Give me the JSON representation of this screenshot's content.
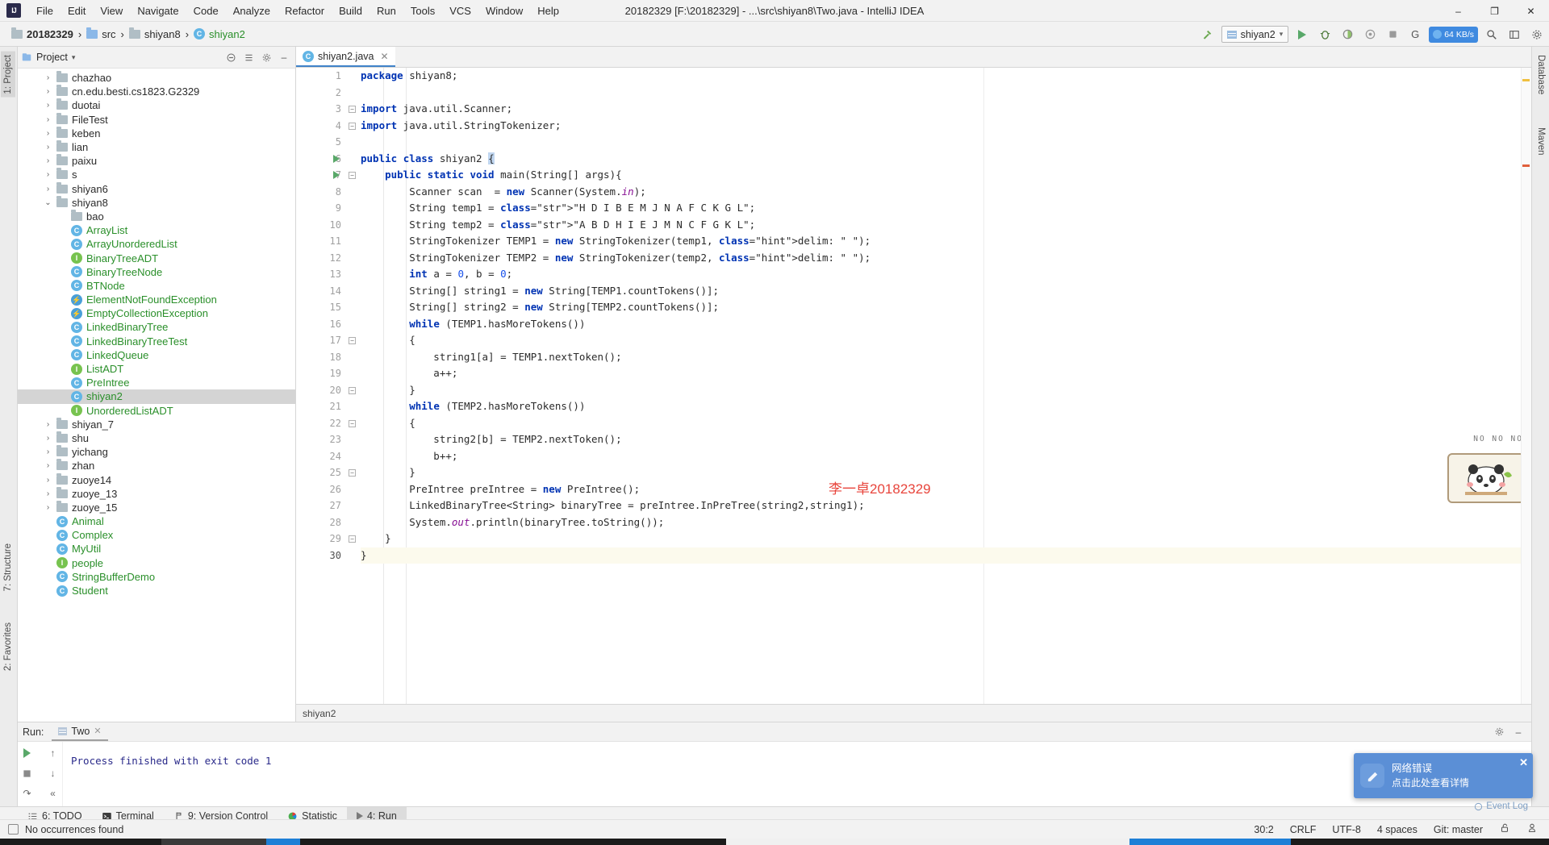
{
  "window": {
    "title": "20182329 [F:\\20182329] - ...\\src\\shiyan8\\Two.java - IntelliJ IDEA",
    "logo": "IJ",
    "minimize": "–",
    "maximize": "❐",
    "close": "✕"
  },
  "menu": [
    "File",
    "Edit",
    "View",
    "Navigate",
    "Code",
    "Analyze",
    "Refactor",
    "Build",
    "Run",
    "Tools",
    "VCS",
    "Window",
    "Help"
  ],
  "breadcrumbs": [
    {
      "label": "20182329",
      "icon": "module-icon",
      "type": "module"
    },
    {
      "label": "src",
      "icon": "source-folder-icon",
      "type": "src"
    },
    {
      "label": "shiyan8",
      "icon": "package-folder-icon",
      "type": "folder"
    },
    {
      "label": "shiyan2",
      "icon": "java-class-icon",
      "type": "class"
    }
  ],
  "toolbar": {
    "build_icon": "hammer-icon",
    "run_config": "shiyan2",
    "run_icon": "run-icon",
    "debug_icon": "debug-icon",
    "coverage_icon": "run-with-coverage-icon",
    "profile_icon": "profiler-icon",
    "stop_icon": "stop-icon",
    "search_icon": "search-icon",
    "layout_icon": "layout-icon",
    "settings_icon": "settings-icon",
    "net_speed": "64 KB/s",
    "git_label": "G"
  },
  "left_tool_tabs": [
    {
      "label": "1: Project",
      "active": true
    },
    {
      "label": "7: Structure",
      "active": false
    },
    {
      "label": "2: Favorites",
      "active": false
    }
  ],
  "right_tool_tabs": [
    {
      "label": "Database",
      "active": false
    },
    {
      "label": "Maven",
      "active": false
    }
  ],
  "project_panel": {
    "title": "Project",
    "chevron": "▾",
    "icons": [
      "collapse-all-icon",
      "expand-all-icon",
      "settings-icon",
      "hide-icon"
    ],
    "tree": [
      {
        "label": "chazhao",
        "depth": 1,
        "type": "folder",
        "arrow": "›",
        "selected": false
      },
      {
        "label": "cn.edu.besti.cs1823.G2329",
        "depth": 1,
        "type": "folder",
        "arrow": "›",
        "selected": false
      },
      {
        "label": "duotai",
        "depth": 1,
        "type": "folder",
        "arrow": "›",
        "selected": false
      },
      {
        "label": "FileTest",
        "depth": 1,
        "type": "folder",
        "arrow": "›",
        "selected": false
      },
      {
        "label": "keben",
        "depth": 1,
        "type": "folder",
        "arrow": "›",
        "selected": false
      },
      {
        "label": "lian",
        "depth": 1,
        "type": "folder",
        "arrow": "›",
        "selected": false
      },
      {
        "label": "paixu",
        "depth": 1,
        "type": "folder",
        "arrow": "›",
        "selected": false
      },
      {
        "label": "s",
        "depth": 1,
        "type": "folder",
        "arrow": "›",
        "selected": false
      },
      {
        "label": "shiyan6",
        "depth": 1,
        "type": "folder",
        "arrow": "›",
        "selected": false
      },
      {
        "label": "shiyan8",
        "depth": 1,
        "type": "folder",
        "arrow": "⌄",
        "selected": false
      },
      {
        "label": "bao",
        "depth": 2,
        "type": "folder",
        "arrow": "",
        "selected": false
      },
      {
        "label": "ArrayList",
        "depth": 2,
        "type": "class",
        "arrow": "",
        "selected": false
      },
      {
        "label": "ArrayUnorderedList",
        "depth": 2,
        "type": "class",
        "arrow": "",
        "selected": false
      },
      {
        "label": "BinaryTreeADT",
        "depth": 2,
        "type": "interface",
        "arrow": "",
        "selected": false
      },
      {
        "label": "BinaryTreeNode",
        "depth": 2,
        "type": "class",
        "arrow": "",
        "selected": false
      },
      {
        "label": "BTNode",
        "depth": 2,
        "type": "class",
        "arrow": "",
        "selected": false
      },
      {
        "label": "ElementNotFoundException",
        "depth": 2,
        "type": "exception",
        "arrow": "",
        "selected": false
      },
      {
        "label": "EmptyCollectionException",
        "depth": 2,
        "type": "exception",
        "arrow": "",
        "selected": false
      },
      {
        "label": "LinkedBinaryTree",
        "depth": 2,
        "type": "class",
        "arrow": "",
        "selected": false
      },
      {
        "label": "LinkedBinaryTreeTest",
        "depth": 2,
        "type": "class-run",
        "arrow": "",
        "selected": false
      },
      {
        "label": "LinkedQueue",
        "depth": 2,
        "type": "class",
        "arrow": "",
        "selected": false
      },
      {
        "label": "ListADT",
        "depth": 2,
        "type": "interface",
        "arrow": "",
        "selected": false
      },
      {
        "label": "PreIntree",
        "depth": 2,
        "type": "class",
        "arrow": "",
        "selected": false
      },
      {
        "label": "shiyan2",
        "depth": 2,
        "type": "class-run",
        "arrow": "",
        "selected": true
      },
      {
        "label": "UnorderedListADT",
        "depth": 2,
        "type": "interface",
        "arrow": "",
        "selected": false
      },
      {
        "label": "shiyan_7",
        "depth": 1,
        "type": "folder",
        "arrow": "›",
        "selected": false
      },
      {
        "label": "shu",
        "depth": 1,
        "type": "folder",
        "arrow": "›",
        "selected": false
      },
      {
        "label": "yichang",
        "depth": 1,
        "type": "folder",
        "arrow": "›",
        "selected": false
      },
      {
        "label": "zhan",
        "depth": 1,
        "type": "folder",
        "arrow": "›",
        "selected": false
      },
      {
        "label": "zuoye14",
        "depth": 1,
        "type": "folder",
        "arrow": "›",
        "selected": false
      },
      {
        "label": "zuoye_13",
        "depth": 1,
        "type": "folder",
        "arrow": "›",
        "selected": false
      },
      {
        "label": "zuoye_15",
        "depth": 1,
        "type": "folder",
        "arrow": "›",
        "selected": false
      },
      {
        "label": "Animal",
        "depth": 1,
        "type": "class-run",
        "arrow": "",
        "selected": false
      },
      {
        "label": "Complex",
        "depth": 1,
        "type": "class",
        "arrow": "",
        "selected": false
      },
      {
        "label": "MyUtil",
        "depth": 1,
        "type": "class",
        "arrow": "",
        "selected": false
      },
      {
        "label": "people",
        "depth": 1,
        "type": "interface",
        "arrow": "",
        "selected": false
      },
      {
        "label": "StringBufferDemo",
        "depth": 1,
        "type": "class-run",
        "arrow": "",
        "selected": false
      },
      {
        "label": "Student",
        "depth": 1,
        "type": "class",
        "arrow": "",
        "selected": false
      }
    ]
  },
  "editor": {
    "tab": {
      "label": "shiyan2.java",
      "icon": "java-class-icon",
      "close": "✕"
    },
    "breadcrumb_bottom": "shiyan2",
    "watermark": "李一卓",
    "watermark_full": "李一卓20182329",
    "lines": [
      {
        "n": 1,
        "text": "package shiyan8;"
      },
      {
        "n": 2,
        "text": ""
      },
      {
        "n": 3,
        "text": "import java.util.Scanner;"
      },
      {
        "n": 4,
        "text": "import java.util.StringTokenizer;"
      },
      {
        "n": 5,
        "text": ""
      },
      {
        "n": 6,
        "text": "public class shiyan2 {"
      },
      {
        "n": 7,
        "text": "    public static void main(String[] args){"
      },
      {
        "n": 8,
        "text": "        Scanner scan  = new Scanner(System.in);"
      },
      {
        "n": 9,
        "text": "        String temp1 = \"H D I B E M J N A F C K G L\";"
      },
      {
        "n": 10,
        "text": "        String temp2 = \"A B D H I E J M N C F G K L\";"
      },
      {
        "n": 11,
        "text": "        StringTokenizer TEMP1 = new StringTokenizer(temp1, delim: \" \");"
      },
      {
        "n": 12,
        "text": "        StringTokenizer TEMP2 = new StringTokenizer(temp2, delim: \" \");"
      },
      {
        "n": 13,
        "text": "        int a = 0, b = 0;"
      },
      {
        "n": 14,
        "text": "        String[] string1 = new String[TEMP1.countTokens()];"
      },
      {
        "n": 15,
        "text": "        String[] string2 = new String[TEMP2.countTokens()];"
      },
      {
        "n": 16,
        "text": "        while (TEMP1.hasMoreTokens())"
      },
      {
        "n": 17,
        "text": "        {"
      },
      {
        "n": 18,
        "text": "            string1[a] = TEMP1.nextToken();"
      },
      {
        "n": 19,
        "text": "            a++;"
      },
      {
        "n": 20,
        "text": "        }"
      },
      {
        "n": 21,
        "text": "        while (TEMP2.hasMoreTokens())"
      },
      {
        "n": 22,
        "text": "        {"
      },
      {
        "n": 23,
        "text": "            string2[b] = TEMP2.nextToken();"
      },
      {
        "n": 24,
        "text": "            b++;"
      },
      {
        "n": 25,
        "text": "        }"
      },
      {
        "n": 26,
        "text": "        PreIntree preIntree = new PreIntree();"
      },
      {
        "n": 27,
        "text": "        LinkedBinaryTree<String> binaryTree = preIntree.InPreTree(string2,string1);"
      },
      {
        "n": 28,
        "text": "        System.out.println(binaryTree.toString());"
      },
      {
        "n": 29,
        "text": "    }"
      },
      {
        "n": 30,
        "text": "}"
      }
    ]
  },
  "run_panel": {
    "label": "Run:",
    "tab": "Two",
    "tab_close": "✕",
    "console_text": "Process finished with exit code 1",
    "settings_icon": "settings-icon",
    "hide_icon": "hide-icon",
    "side_icons": [
      "rerun-icon",
      "scroll-up-icon",
      "stop-icon",
      "scroll-down-icon",
      "soft-wrap-icon",
      "expand-icon"
    ]
  },
  "tool_window_bar": [
    {
      "label": "6: TODO",
      "mnemonic": "6",
      "icon": "todo-icon",
      "active": false
    },
    {
      "label": "Terminal",
      "mnemonic": "",
      "icon": "terminal-icon",
      "active": false
    },
    {
      "label": "9: Version Control",
      "mnemonic": "9",
      "icon": "vcs-icon",
      "active": false
    },
    {
      "label": "Statistic",
      "mnemonic": "",
      "icon": "statistic-icon",
      "active": false
    },
    {
      "label": "4: Run",
      "mnemonic": "4",
      "icon": "run-icon",
      "active": true
    }
  ],
  "status_bar": {
    "message": "No occurrences found",
    "message_icon": "console-icon",
    "position": "30:2",
    "line_sep": "CRLF",
    "encoding": "UTF-8",
    "indent": "4 spaces",
    "branch": "Git: master",
    "lock_icon": "unlock-icon",
    "inspection_icon": "inspector-icon"
  },
  "notification": {
    "title": "网络错误",
    "subtitle": "点击此处查看详情",
    "close": "✕",
    "icon": "edit-icon",
    "event_log": "Event Log",
    "accent": "#5b8fd6"
  },
  "pet_widget": {
    "caption": "NO NO NO",
    "name": "desktop-pet"
  }
}
